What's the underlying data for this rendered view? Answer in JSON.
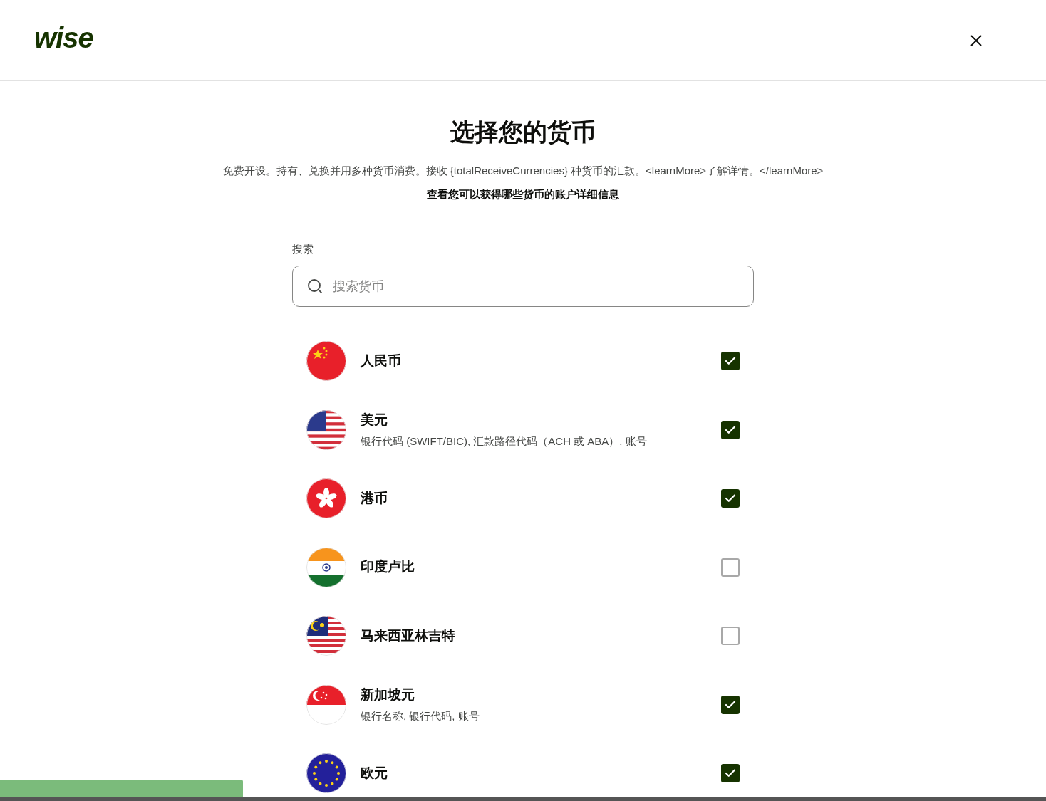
{
  "logo": {
    "text": "wise"
  },
  "title": "选择您的货币",
  "description": "免费开设。持有、兑换并用多种货币消费。接收 {totalReceiveCurrencies} 种货币的汇款。<learnMore>了解详情。</learnMore>",
  "details_link": "查看您可以获得哪些货币的账户详细信息",
  "search": {
    "label": "搜索",
    "placeholder": "搜索货币"
  },
  "currencies": [
    {
      "kind": "cn",
      "name": "人民币",
      "checked": true
    },
    {
      "kind": "us",
      "name": "美元",
      "details": "银行代码 (SWIFT/BIC), 汇款路径代码（ACH 或 ABA）, 账号",
      "checked": true
    },
    {
      "kind": "hk",
      "name": "港币",
      "checked": true
    },
    {
      "kind": "in",
      "name": "印度卢比",
      "checked": false
    },
    {
      "kind": "my",
      "name": "马来西亚林吉特",
      "checked": false
    },
    {
      "kind": "sg",
      "name": "新加坡元",
      "details": "银行名称, 银行代码, 账号",
      "checked": true
    },
    {
      "kind": "eu",
      "name": "欧元",
      "checked": true
    }
  ]
}
